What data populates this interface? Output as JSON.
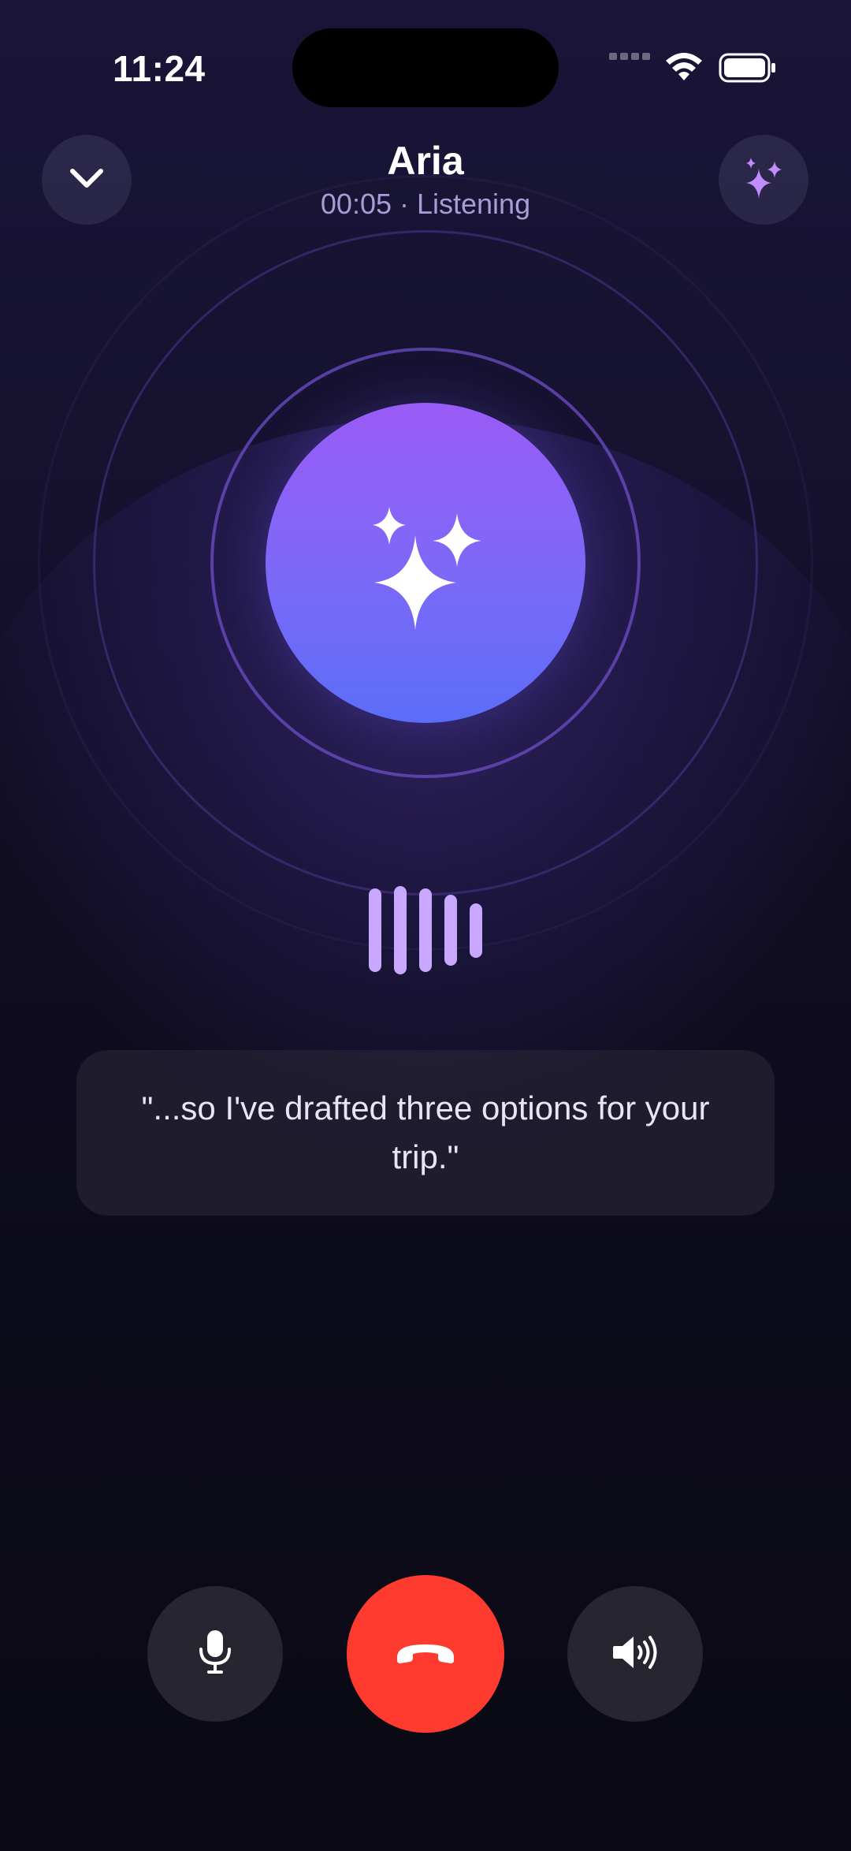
{
  "status_bar": {
    "time": "11:24",
    "icons": [
      "cellular-dots-icon",
      "wifi-icon",
      "battery-icon"
    ]
  },
  "header": {
    "collapse_icon": "chevron-down-icon",
    "caller_name": "Aria",
    "call_status": "00:05 · Listening",
    "action_icon": "sparkles-icon"
  },
  "orb": {
    "icon": "sparkles-icon",
    "gradient_top": "#9a5cf6",
    "gradient_bottom": "#5b6ef9"
  },
  "voice_wave": {
    "bar_levels": [
      0.95,
      1.0,
      0.95,
      0.8,
      0.62
    ],
    "color": "#c8a8ff"
  },
  "transcript": {
    "text": "\"...so I've drafted three options for your trip.\""
  },
  "controls": {
    "mute_icon": "microphone-icon",
    "end_call_icon": "phone-hangup-icon",
    "end_call_color": "#ff3b30",
    "speaker_icon": "speaker-wave-icon"
  },
  "colors": {
    "background_top": "#1a1538",
    "background_bottom": "#0a0914",
    "accent": "#c8a8ff"
  }
}
